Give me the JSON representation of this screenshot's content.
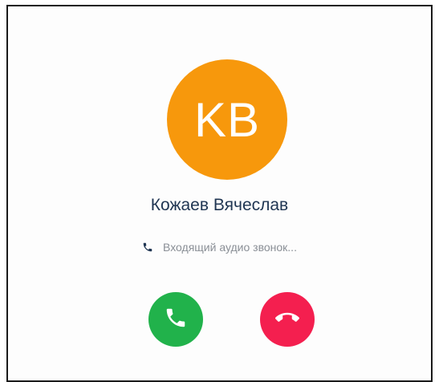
{
  "caller": {
    "initials": "KB",
    "name": "Кожаев Вячеслав",
    "status": "Входящий аудио звонок..."
  },
  "icons": {
    "status": "phone-icon",
    "accept": "phone-accept-icon",
    "decline": "phone-hangup-icon"
  },
  "colors": {
    "avatar": "#f7980c",
    "name": "#1f3552",
    "status_text": "#8a8f96",
    "status_icon": "#1f3552",
    "accept": "#21b24b",
    "decline": "#f41f4f"
  }
}
